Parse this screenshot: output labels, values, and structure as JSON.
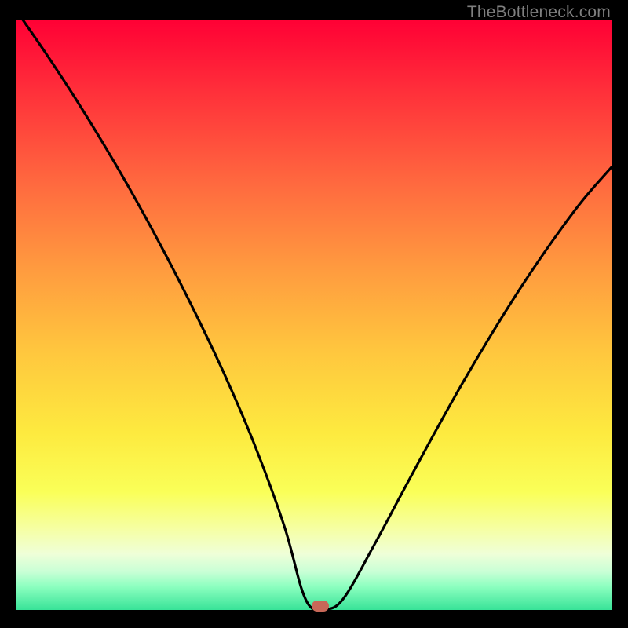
{
  "attribution": "TheBottleneck.com",
  "chart_data": {
    "type": "line",
    "title": "",
    "xlabel": "",
    "ylabel": "",
    "xlim": [
      0,
      100
    ],
    "ylim": [
      0,
      100
    ],
    "x": [
      0,
      5,
      10,
      15,
      20,
      25,
      30,
      35,
      40,
      45,
      48,
      50,
      52,
      55,
      60,
      65,
      70,
      75,
      80,
      85,
      90,
      95,
      100
    ],
    "values": [
      101.5,
      94.2,
      86.5,
      78.3,
      69.6,
      60.3,
      50.4,
      39.8,
      28.0,
      14.2,
      3.3,
      0.0,
      0.0,
      2.0,
      10.8,
      20.2,
      29.5,
      38.5,
      47.0,
      55.0,
      62.4,
      69.2,
      75.0
    ],
    "marker": {
      "x": 51,
      "y": 0
    },
    "annotations": []
  },
  "colors": {
    "curve": "#000000",
    "marker": "#c86858"
  }
}
